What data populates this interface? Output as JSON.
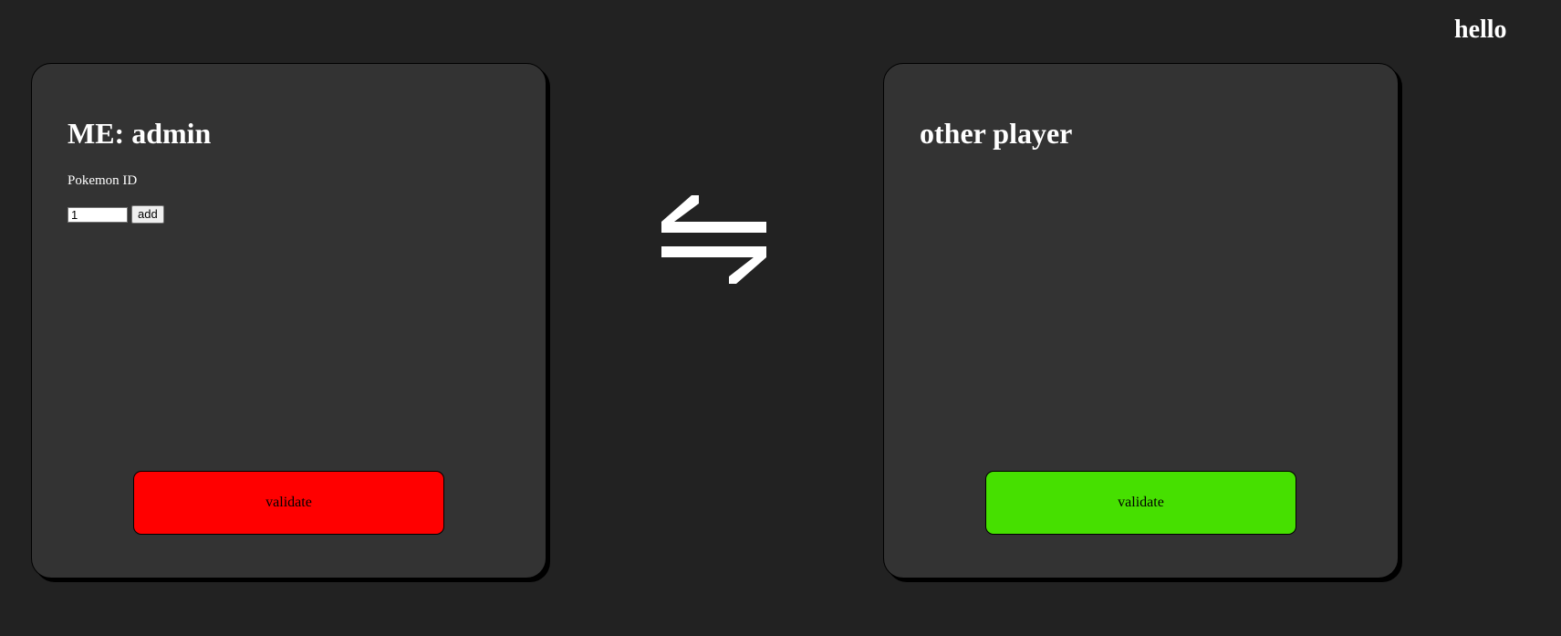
{
  "header": {
    "greeting": "hello"
  },
  "me_panel": {
    "title": "ME: admin",
    "pokemon_id_label": "Pokemon ID",
    "pokemon_id_value": "1",
    "add_label": "add",
    "validate_label": "validate",
    "validate_color": "#ff0000"
  },
  "swap": {
    "icon": "swap-arrows-icon"
  },
  "other_panel": {
    "title": "other player",
    "validate_label": "validate",
    "validate_color": "#46e000"
  },
  "colors": {
    "background": "#222222",
    "panel": "#333333",
    "text": "#ffffff"
  }
}
